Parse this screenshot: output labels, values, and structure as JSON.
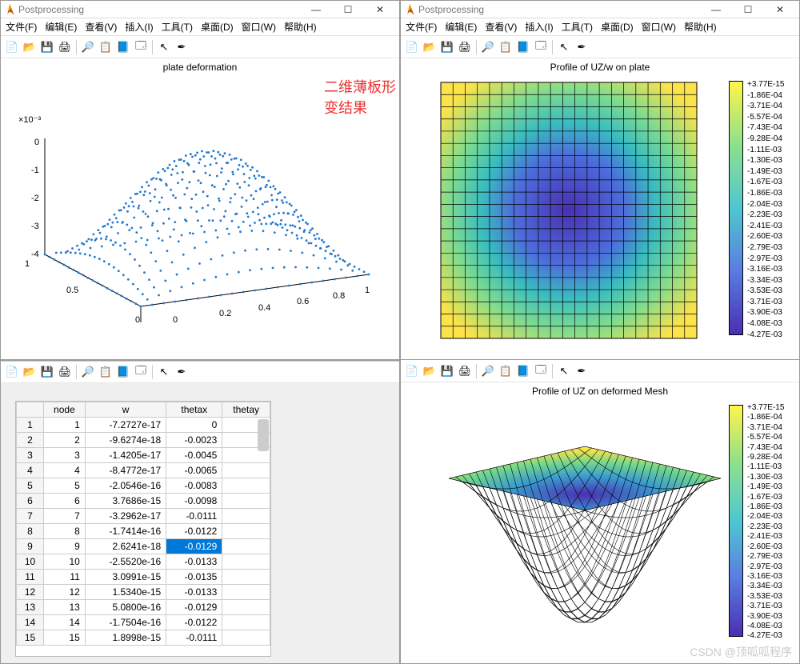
{
  "windows": {
    "left": {
      "title": "Postprocessing"
    },
    "right": {
      "title": "Postprocessing"
    }
  },
  "title_controls": {
    "min": "—",
    "max": "☐",
    "close": "✕"
  },
  "menu": {
    "items": [
      "文件(F)",
      "编辑(E)",
      "查看(V)",
      "插入(I)",
      "工具(T)",
      "桌面(D)",
      "窗口(W)",
      "帮助(H)"
    ]
  },
  "toolbar_icons": [
    "📄",
    "📂",
    "💾",
    "🖨",
    "",
    "🔎",
    "📋",
    "📘",
    "🗔",
    "",
    "↖",
    "✒"
  ],
  "annotation": "二维薄板形变结果",
  "watermark": "CSDN @顶呱呱程序",
  "table": {
    "headers": [
      "",
      "node",
      "w",
      "thetax",
      "thetay"
    ],
    "rows": [
      {
        "i": 1,
        "node": 1,
        "w": "-7.2727e-17",
        "thetax": "0",
        "thetay": ""
      },
      {
        "i": 2,
        "node": 2,
        "w": "-9.6274e-18",
        "thetax": "-0.0023",
        "thetay": ""
      },
      {
        "i": 3,
        "node": 3,
        "w": "-1.4205e-17",
        "thetax": "-0.0045",
        "thetay": ""
      },
      {
        "i": 4,
        "node": 4,
        "w": "-8.4772e-17",
        "thetax": "-0.0065",
        "thetay": ""
      },
      {
        "i": 5,
        "node": 5,
        "w": "-2.0546e-16",
        "thetax": "-0.0083",
        "thetay": ""
      },
      {
        "i": 6,
        "node": 6,
        "w": "3.7686e-15",
        "thetax": "-0.0098",
        "thetay": ""
      },
      {
        "i": 7,
        "node": 7,
        "w": "-3.2962e-17",
        "thetax": "-0.0111",
        "thetay": ""
      },
      {
        "i": 8,
        "node": 8,
        "w": "-1.7414e-16",
        "thetax": "-0.0122",
        "thetay": ""
      },
      {
        "i": 9,
        "node": 9,
        "w": "2.6241e-18",
        "thetax": "-0.0129",
        "thetay": "",
        "sel": true
      },
      {
        "i": 10,
        "node": 10,
        "w": "-2.5520e-16",
        "thetax": "-0.0133",
        "thetay": ""
      },
      {
        "i": 11,
        "node": 11,
        "w": "3.0991e-15",
        "thetax": "-0.0135",
        "thetay": ""
      },
      {
        "i": 12,
        "node": 12,
        "w": "1.5340e-15",
        "thetax": "-0.0133",
        "thetay": ""
      },
      {
        "i": 13,
        "node": 13,
        "w": "5.0800e-16",
        "thetax": "-0.0129",
        "thetay": ""
      },
      {
        "i": 14,
        "node": 14,
        "w": "-1.7504e-16",
        "thetax": "-0.0122",
        "thetay": ""
      },
      {
        "i": 15,
        "node": 15,
        "w": "1.8998e-15",
        "thetax": "-0.0111",
        "thetay": ""
      }
    ]
  },
  "colorbar_ticks": [
    "+3.77E-15",
    "-1.86E-04",
    "-3.71E-04",
    "-5.57E-04",
    "-7.43E-04",
    "-9.28E-04",
    "-1.11E-03",
    "-1.30E-03",
    "-1.49E-03",
    "-1.67E-03",
    "-1.86E-03",
    "-2.04E-03",
    "-2.23E-03",
    "-2.41E-03",
    "-2.60E-03",
    "-2.79E-03",
    "-2.97E-03",
    "-3.16E-03",
    "-3.34E-03",
    "-3.53E-03",
    "-3.71E-03",
    "-3.90E-03",
    "-4.08E-03",
    "-4.27E-03"
  ],
  "chart_data": [
    {
      "type": "scatter3d",
      "title": "plate deformation",
      "zscale": "×10⁻³",
      "xlim": [
        0,
        1
      ],
      "ylim": [
        0,
        1
      ],
      "zlim": [
        -4,
        0
      ],
      "xticks": [
        0,
        0.2,
        0.4,
        0.6,
        0.8,
        1
      ],
      "yticks": [
        0,
        0.5,
        1
      ],
      "zticks": [
        0,
        -1,
        -2,
        -3,
        -4
      ],
      "description": "scattered nodes of square plate sagging bowl shape, min ≈ -4e-3 near center"
    },
    {
      "type": "heatmap",
      "title": "Profile of UZ/w on plate",
      "grid": "21x21",
      "vmin": -0.00427,
      "vmax": 3.77e-15,
      "pattern": "radial bowl — edges ≈0, center ≈ -4.27e-3",
      "colormap": "parula"
    },
    {
      "type": "surface",
      "title": "Profile of UZ on deformed Mesh",
      "grid": "21x21",
      "vmin": -0.00427,
      "vmax": 3.77e-15,
      "colormap": "parula",
      "description": "deformed square plate mesh sagging downward, edges at 0, center at min"
    }
  ]
}
